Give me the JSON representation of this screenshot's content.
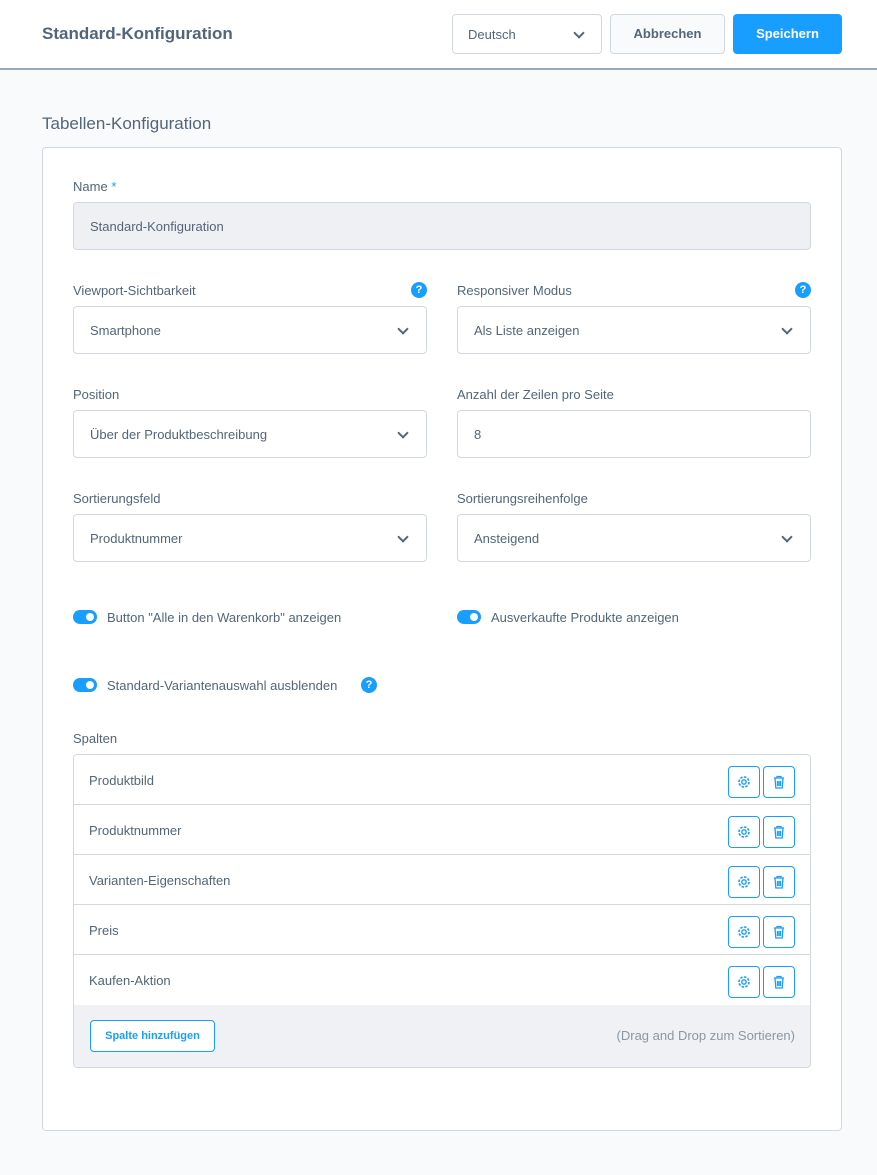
{
  "header": {
    "title": "Standard-Konfiguration",
    "language": "Deutsch",
    "cancel_label": "Abbrechen",
    "save_label": "Speichern"
  },
  "section_title": "Tabellen-Konfiguration",
  "form": {
    "name": {
      "label": "Name",
      "required_mark": "*",
      "value": "Standard-Konfiguration"
    },
    "viewport": {
      "label": "Viewport-Sichtbarkeit",
      "value": "Smartphone"
    },
    "responsive": {
      "label": "Responsiver Modus",
      "value": "Als Liste anzeigen"
    },
    "position": {
      "label": "Position",
      "value": "Über der Produktbeschreibung"
    },
    "rows_per_page": {
      "label": "Anzahl der Zeilen pro Seite",
      "value": "8"
    },
    "sort_field": {
      "label": "Sortierungsfeld",
      "value": "Produktnummer"
    },
    "sort_order": {
      "label": "Sortierungsreihenfolge",
      "value": "Ansteigend"
    },
    "toggles": [
      {
        "label": "Button \"Alle in den Warenkorb\" anzeigen",
        "checked": true
      },
      {
        "label": "Ausverkaufte Produkte anzeigen",
        "checked": true
      },
      {
        "label": "Standard-Variantenauswahl ausblenden",
        "checked": true
      }
    ],
    "help_glyph": "?"
  },
  "columns": {
    "label": "Spalten",
    "items": [
      {
        "name": "Produktbild"
      },
      {
        "name": "Produktnummer"
      },
      {
        "name": "Varianten-Eigenschaften"
      },
      {
        "name": "Preis"
      },
      {
        "name": "Kaufen-Aktion"
      }
    ],
    "add_label": "Spalte hinzufügen",
    "hint": "(Drag and Drop zum Sortieren)"
  }
}
